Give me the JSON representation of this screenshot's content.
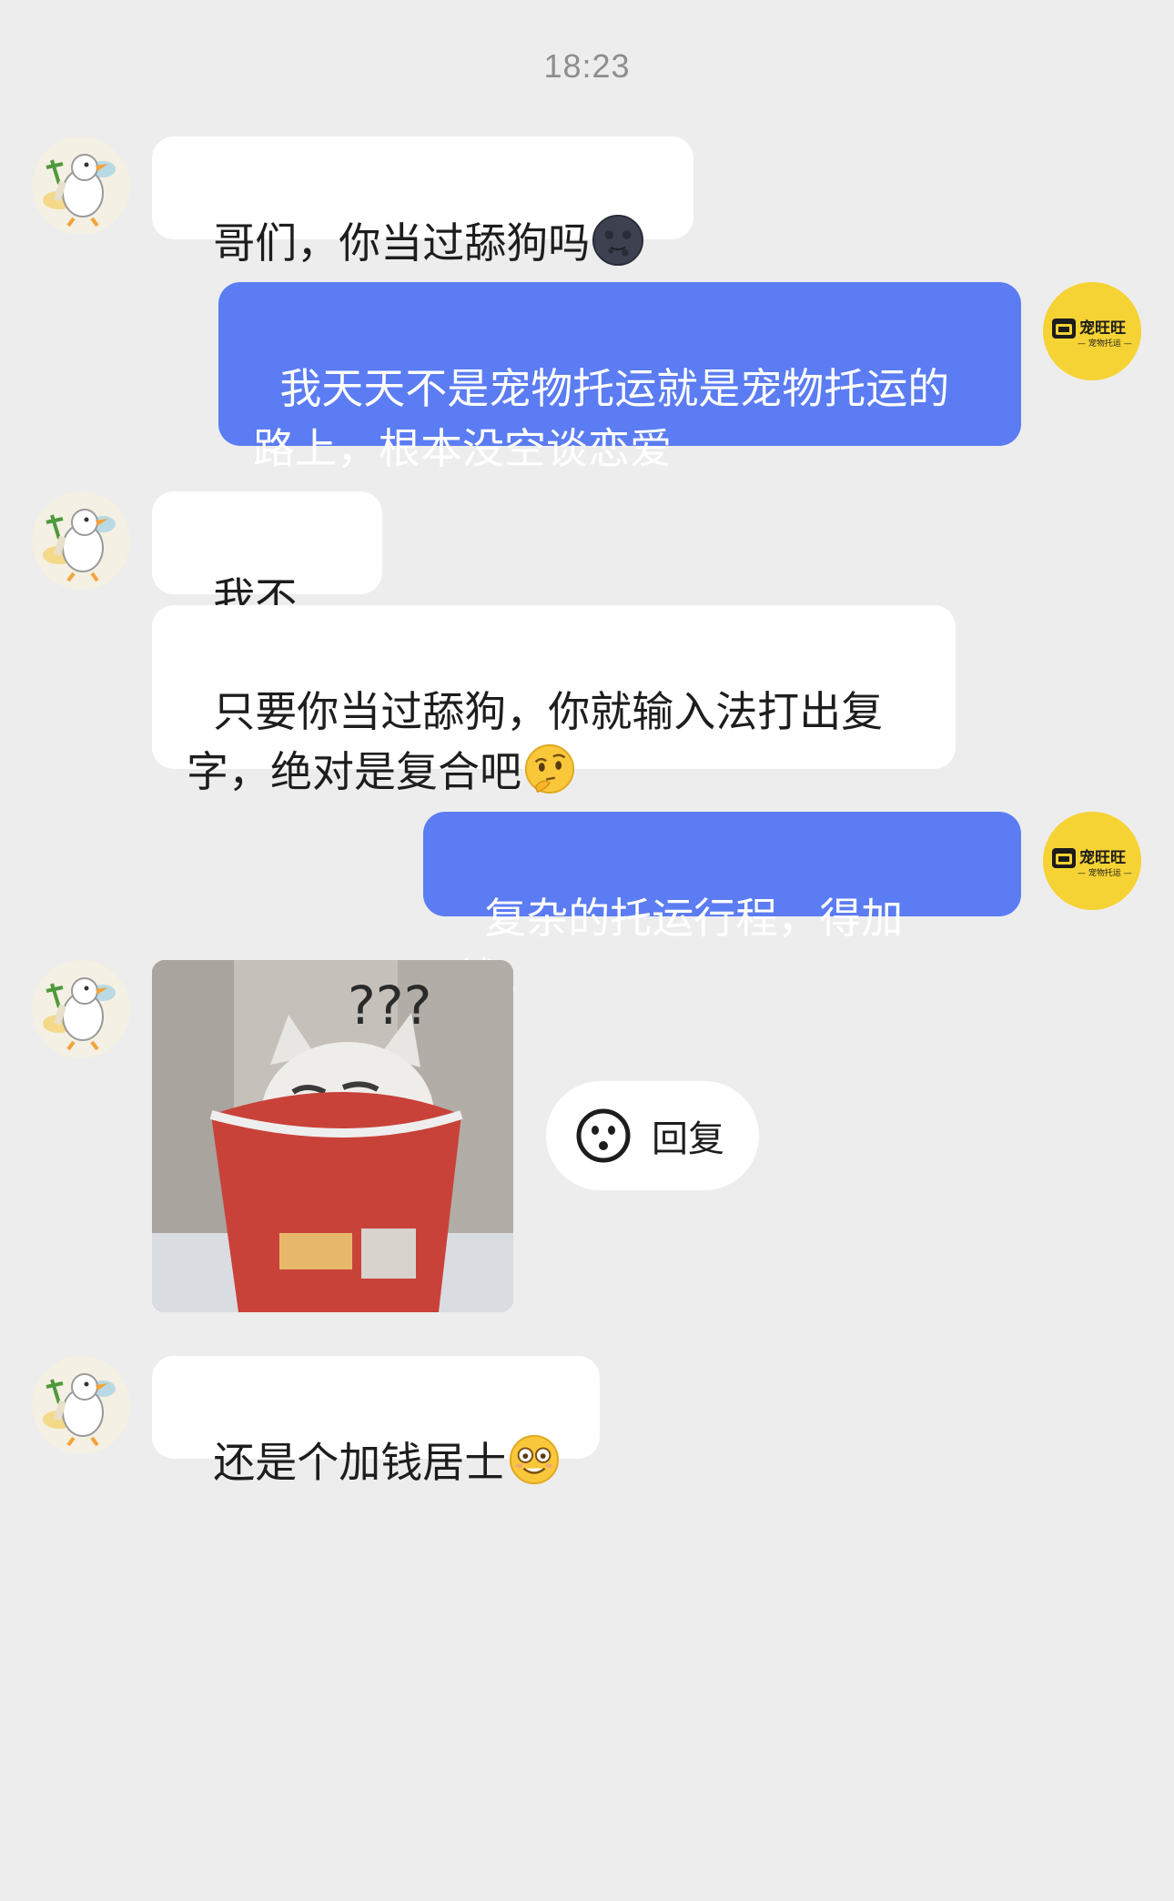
{
  "chat": {
    "timestamp": "18:23",
    "messages": [
      {
        "from": "contact",
        "text": "哥们，你当过舔狗吗",
        "emoji": "dark-moon-face-icon"
      },
      {
        "from": "me",
        "text": "我天天不是宠物托运就是宠物托运的路上，根本没空谈恋爱"
      },
      {
        "from": "contact",
        "text": "我不信!"
      },
      {
        "from": "contact",
        "text": "只要你当过舔狗，你就输入法打出复字，绝对是复合吧",
        "emoji": "thinking-face-icon"
      },
      {
        "from": "me",
        "text": "复杂的托运行程，得加钱。"
      },
      {
        "from": "contact",
        "sticker": {
          "caption": "???"
        }
      },
      {
        "from": "contact",
        "text": "还是个加钱居士",
        "emoji": "flushed-grin-face-icon"
      }
    ],
    "reply_button": {
      "label": "回复",
      "icon": "emoji-face-icon"
    }
  },
  "avatars": {
    "contact": {
      "icon": "duck-avatar-icon"
    },
    "me": {
      "icon": "brand-logo-icon",
      "logo_text": "宠旺旺",
      "logo_subtext": "— 宠物托运 —",
      "bg_color": "#f6d334"
    }
  },
  "colors": {
    "background": "#ededed",
    "outgoing_bubble": "#5b7cf2",
    "incoming_bubble": "#ffffff"
  }
}
